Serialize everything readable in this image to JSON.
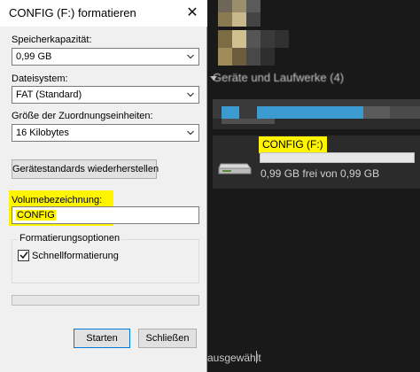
{
  "dialog": {
    "title": "CONFIG (F:) formatieren",
    "capacity_label": "Speicherkapazität:",
    "capacity_value": "0,99 GB",
    "filesystem_label": "Dateisystem:",
    "filesystem_value": "FAT (Standard)",
    "allocation_label": "Größe der Zuordnungseinheiten:",
    "allocation_value": "16 Kilobytes",
    "restore_defaults_label": "Gerätestandards wiederherstellen",
    "volume_label": "Volumebezeichnung:",
    "volume_value": "CONFIG",
    "options_group_title": "Formatierungsoptionen",
    "quick_format_label": "Schnellformatierung",
    "quick_format_checked": true,
    "progress": 0,
    "start_label": "Starten",
    "close_label": "Schließen"
  },
  "explorer": {
    "section_header": "Geräte und Laufwerke (4)",
    "drive_name": "CONFIG (F:)",
    "drive_free_text": "0,99 GB frei von 0,99 GB",
    "drive_used_fraction": 0,
    "status_text": "ausgewählt"
  },
  "colors": {
    "highlight": "#fff500",
    "dialog_bg": "#f0f0f0",
    "explorer_bg": "#191919",
    "accent_blue": "#3b9bd1"
  },
  "icons": {
    "close": "close-icon",
    "dropdown": "chevron-down-icon",
    "check": "checkmark-icon",
    "drive": "usb-drive-icon"
  }
}
